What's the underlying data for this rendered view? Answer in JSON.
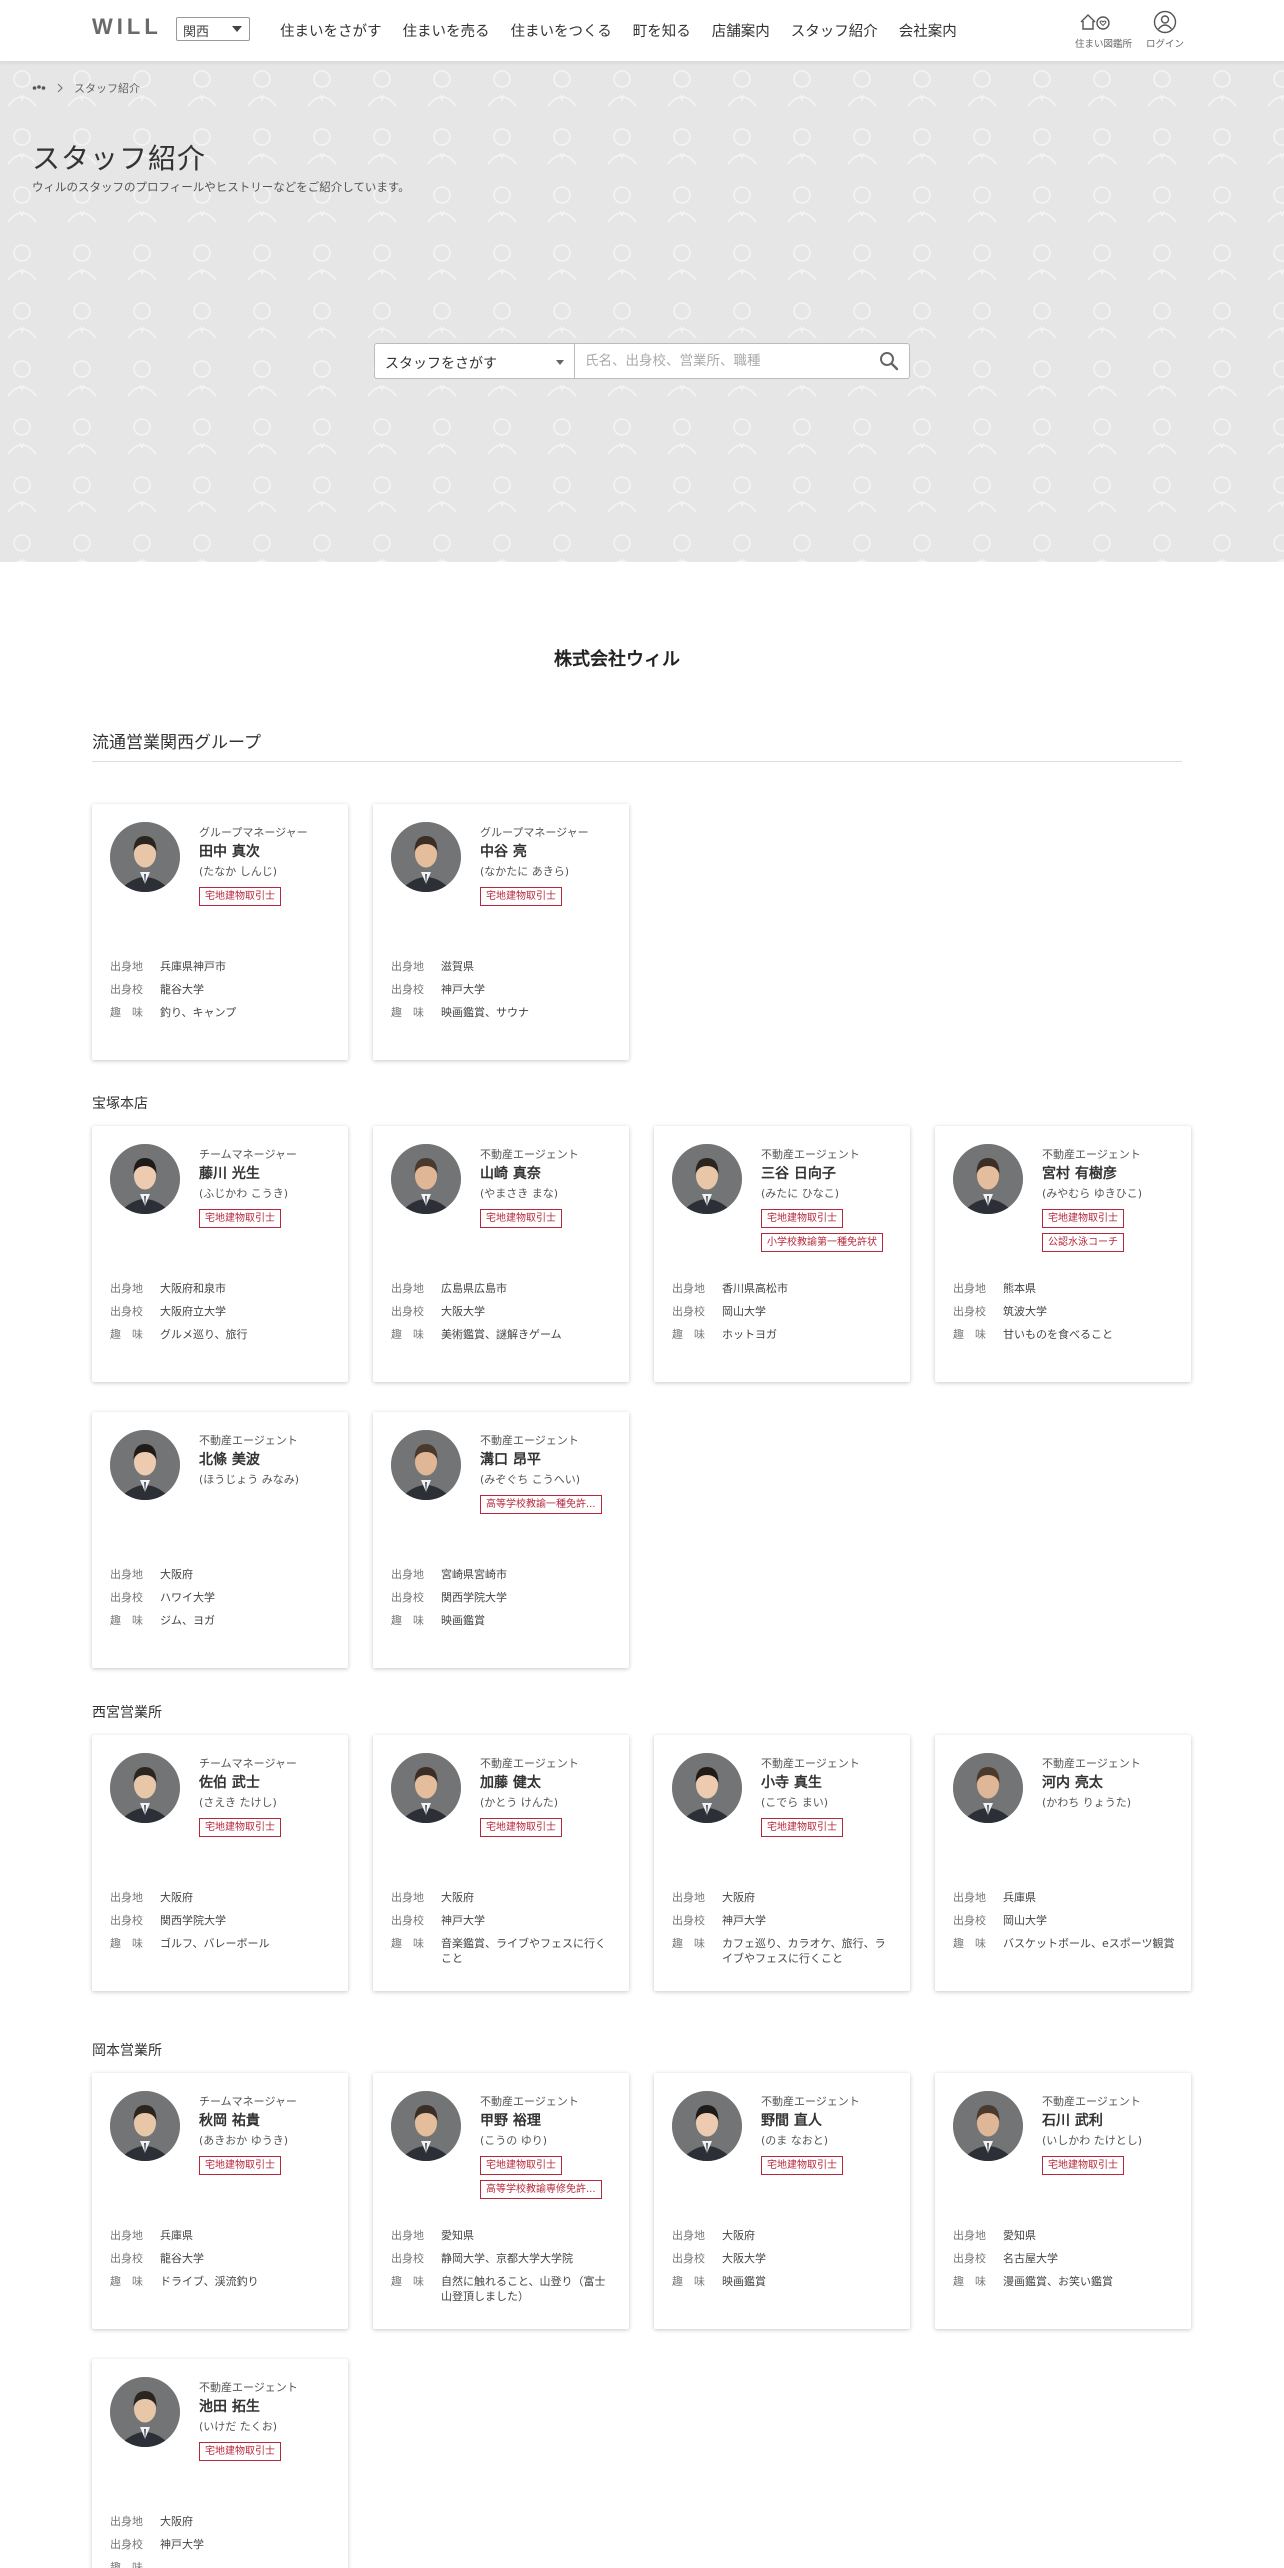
{
  "header": {
    "logo": "WILL",
    "region": "関西",
    "nav": [
      "住まいをさがす",
      "住まいを売る",
      "住まいをつくる",
      "町を知る",
      "店舗案内",
      "スタッフ紹介",
      "会社案内"
    ],
    "icon_labels": {
      "consult": "住まい図鑑所",
      "login": "ログイン"
    }
  },
  "hero": {
    "breadcrumb_current": "スタッフ紹介",
    "title": "スタッフ紹介",
    "subtitle": "ウィルのスタッフのプロフィールやヒストリーなどをご紹介しています。",
    "search_select": "スタッフをさがす",
    "search_placeholder": "氏名、出身校、営業所、職種"
  },
  "company": "株式会社ウィル",
  "group_title": "流通営業関西グループ",
  "info_labels": {
    "birthplace": "出身地",
    "school": "出身校",
    "hobby": "趣　味"
  },
  "offices": [
    {
      "name": "",
      "staff": [
        {
          "role": "グループマネージャー",
          "name": "田中 真次",
          "kana": "(たなか しんじ)",
          "badges": [
            "宅地建物取引士"
          ],
          "birthplace": "兵庫県神戸市",
          "school": "龍谷大学",
          "hobby": "釣り、キャンプ"
        },
        {
          "role": "グループマネージャー",
          "name": "中谷 亮",
          "kana": "(なかたに あきら)",
          "badges": [
            "宅地建物取引士"
          ],
          "birthplace": "滋賀県",
          "school": "神戸大学",
          "hobby": "映画鑑賞、サウナ"
        }
      ]
    },
    {
      "name": "宝塚本店",
      "staff": [
        {
          "role": "チームマネージャー",
          "name": "藤川 光生",
          "kana": "(ふじかわ こうき)",
          "badges": [
            "宅地建物取引士"
          ],
          "birthplace": "大阪府和泉市",
          "school": "大阪府立大学",
          "hobby": "グルメ巡り、旅行"
        },
        {
          "role": "不動産エージェント",
          "name": "山崎 真奈",
          "kana": "(やまさき まな)",
          "badges": [
            "宅地建物取引士"
          ],
          "birthplace": "広島県広島市",
          "school": "大阪大学",
          "hobby": "美術鑑賞、謎解きゲーム"
        },
        {
          "role": "不動産エージェント",
          "name": "三谷 日向子",
          "kana": "(みたに ひなこ)",
          "badges": [
            "宅地建物取引士",
            "小学校教諭第一種免許状"
          ],
          "birthplace": "香川県高松市",
          "school": "岡山大学",
          "hobby": "ホットヨガ"
        },
        {
          "role": "不動産エージェント",
          "name": "宮村 有樹彦",
          "kana": "(みやむら ゆきひこ)",
          "badges": [
            "宅地建物取引士",
            "公認水泳コーチ"
          ],
          "birthplace": "熊本県",
          "school": "筑波大学",
          "hobby": "甘いものを食べること"
        },
        {
          "role": "不動産エージェント",
          "name": "北條 美波",
          "kana": "(ほうじょう みなみ)",
          "badges": [],
          "birthplace": "大阪府",
          "school": "ハワイ大学",
          "hobby": "ジム、ヨガ"
        },
        {
          "role": "不動産エージェント",
          "name": "溝口 昂平",
          "kana": "(みぞぐち こうへい)",
          "badges": [
            "高等学校教諭一種免許..."
          ],
          "birthplace": "宮崎県宮崎市",
          "school": "関西学院大学",
          "hobby": "映画鑑賞"
        }
      ]
    },
    {
      "name": "西宮営業所",
      "staff": [
        {
          "role": "チームマネージャー",
          "name": "佐伯 武士",
          "kana": "(さえき たけし)",
          "badges": [
            "宅地建物取引士"
          ],
          "birthplace": "大阪府",
          "school": "関西学院大学",
          "hobby": "ゴルフ、バレーボール"
        },
        {
          "role": "不動産エージェント",
          "name": "加藤 健太",
          "kana": "(かとう けんた)",
          "badges": [
            "宅地建物取引士"
          ],
          "birthplace": "大阪府",
          "school": "神戸大学",
          "hobby": "音楽鑑賞、ライブやフェスに行くこと"
        },
        {
          "role": "不動産エージェント",
          "name": "小寺 真生",
          "kana": "(こでら まい)",
          "badges": [
            "宅地建物取引士"
          ],
          "birthplace": "大阪府",
          "school": "神戸大学",
          "hobby": "カフェ巡り、カラオケ、旅行、ライブやフェスに行くこと"
        },
        {
          "role": "不動産エージェント",
          "name": "河内 亮太",
          "kana": "(かわち りょうた)",
          "badges": [],
          "birthplace": "兵庫県",
          "school": "岡山大学",
          "hobby": "バスケットボール、eスポーツ観賞"
        }
      ]
    },
    {
      "name": "岡本営業所",
      "staff": [
        {
          "role": "チームマネージャー",
          "name": "秋岡 祐貴",
          "kana": "(あきおか ゆうき)",
          "badges": [
            "宅地建物取引士"
          ],
          "birthplace": "兵庫県",
          "school": "龍谷大学",
          "hobby": "ドライブ、渓流釣り"
        },
        {
          "role": "不動産エージェント",
          "name": "甲野 裕理",
          "kana": "(こうの ゆり)",
          "badges": [
            "宅地建物取引士",
            "高等学校教諭専修免許..."
          ],
          "birthplace": "愛知県",
          "school": "静岡大学、京都大学大学院",
          "hobby": "自然に触れること、山登り（富士山登頂しました）"
        },
        {
          "role": "不動産エージェント",
          "name": "野間 直人",
          "kana": "(のま なおと)",
          "badges": [
            "宅地建物取引士"
          ],
          "birthplace": "大阪府",
          "school": "大阪大学",
          "hobby": "映画鑑賞"
        },
        {
          "role": "不動産エージェント",
          "name": "石川 武利",
          "kana": "(いしかわ たけとし)",
          "badges": [
            "宅地建物取引士"
          ],
          "birthplace": "愛知県",
          "school": "名古屋大学",
          "hobby": "漫画鑑賞、お笑い鑑賞"
        },
        {
          "role": "不動産エージェント",
          "name": "池田 拓生",
          "kana": "(いけだ たくお)",
          "badges": [
            "宅地建物取引士"
          ],
          "birthplace": "大阪府",
          "school": "神戸大学",
          "hobby": ""
        }
      ]
    }
  ],
  "colors": {
    "accent": "#b5283b",
    "hero_bg": "#e6e6e6"
  }
}
